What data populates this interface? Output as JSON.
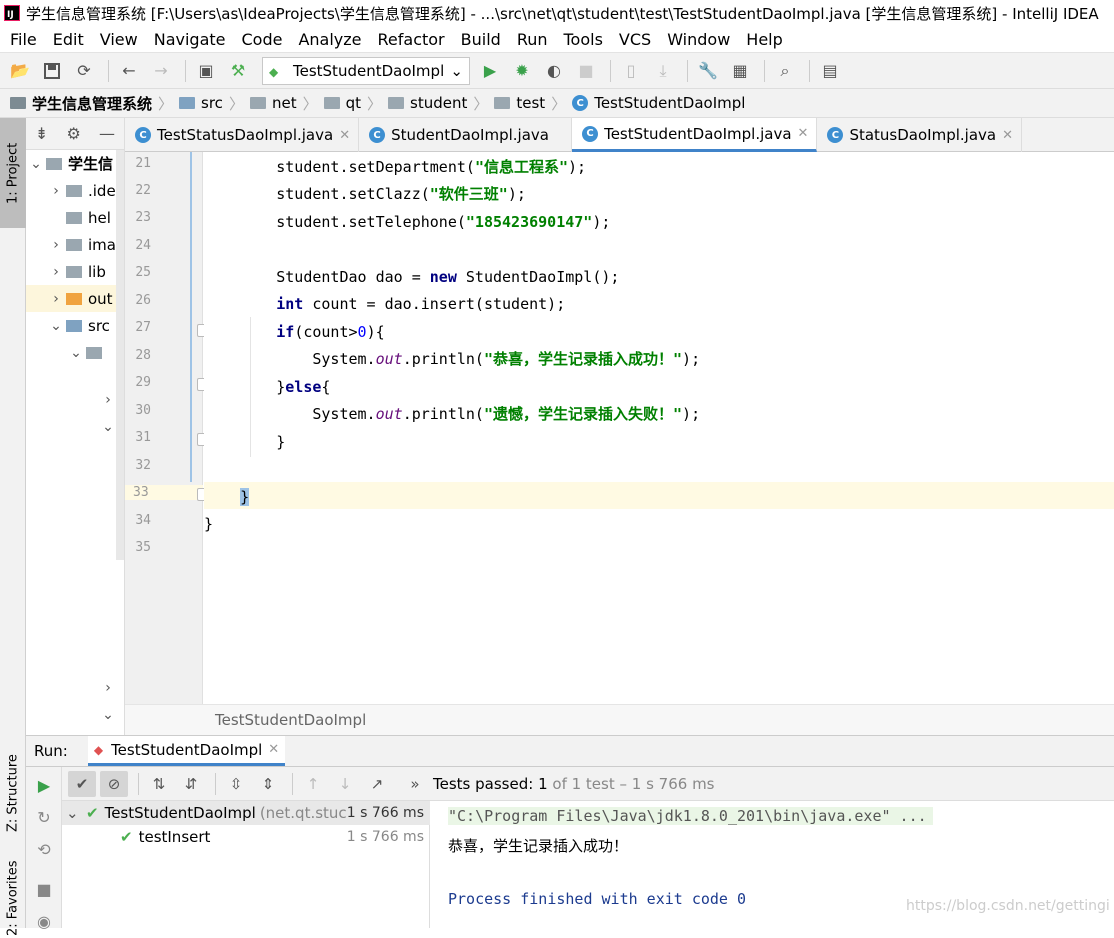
{
  "window": {
    "title": "学生信息管理系统 [F:\\Users\\as\\IdeaProjects\\学生信息管理系统] - ...\\src\\net\\qt\\student\\test\\TestStudentDaoImpl.java [学生信息管理系统] - IntelliJ IDEA",
    "icon": "intellij-icon"
  },
  "menu": [
    "File",
    "Edit",
    "View",
    "Navigate",
    "Code",
    "Analyze",
    "Refactor",
    "Build",
    "Run",
    "Tools",
    "VCS",
    "Window",
    "Help"
  ],
  "toolbar": {
    "run_config": "TestStudentDaoImpl"
  },
  "breadcrumb": [
    "学生信息管理系统",
    "src",
    "net",
    "qt",
    "student",
    "test",
    "TestStudentDaoImpl"
  ],
  "project": {
    "side_tab": "1: Project",
    "items": [
      {
        "label": "学生信",
        "arrow": "⌄"
      },
      {
        "label": ".ide",
        "arrow": "›"
      },
      {
        "label": "hel",
        "arrow": ""
      },
      {
        "label": "ima",
        "arrow": "›"
      },
      {
        "label": "lib",
        "arrow": "›"
      },
      {
        "label": "out",
        "arrow": "›"
      },
      {
        "label": "src",
        "arrow": "⌄"
      },
      {
        "label": "",
        "arrow": "⌄"
      }
    ]
  },
  "tabs": [
    {
      "label": "TestStatusDaoImpl.java",
      "active": false
    },
    {
      "label": "StudentDaoImpl.java",
      "active": false
    },
    {
      "label": "TestStudentDaoImpl.java",
      "active": true
    },
    {
      "label": "StatusDaoImpl.java",
      "active": false
    }
  ],
  "code": {
    "line_numbers": [
      "21",
      "22",
      "23",
      "24",
      "25",
      "26",
      "27",
      "28",
      "29",
      "30",
      "31",
      "32",
      "33",
      "34",
      "35"
    ],
    "lines": [
      {
        "pre": "        student.setDepartment(",
        "str": "\"信息工程系\"",
        "post": ");"
      },
      {
        "pre": "        student.setClazz(",
        "str": "\"软件三班\"",
        "post": ");"
      },
      {
        "pre": "        student.setTelephone(",
        "str": "\"185423690147\"",
        "post": ");"
      }
    ],
    "l25": {
      "a": "        StudentDao dao = ",
      "kw": "new",
      "b": " StudentDaoImpl();"
    },
    "l26": {
      "kw": "int",
      "b": " count = dao.insert(student);"
    },
    "l27": {
      "kw": "if",
      "b": "(count>",
      "num": "0",
      "c": "){"
    },
    "l28": {
      "a": "            System.",
      "fld": "out",
      "b": ".println(",
      "str": "\"恭喜，学生记录插入成功！\"",
      "c": ");"
    },
    "l29": {
      "a": "        }",
      "kw": "else",
      "b": "{"
    },
    "l30": {
      "a": "            System.",
      "fld": "out",
      "b": ".println(",
      "str": "\"遗憾，学生记录插入失败！\"",
      "c": ");"
    },
    "l31": "        }",
    "l33": "    }",
    "l34": "}"
  },
  "editor_footer": "TestStudentDaoImpl",
  "run": {
    "label": "Run:",
    "tab": "TestStudentDaoImpl",
    "status_prefix": "Tests passed:",
    "status_count": "1",
    "status_suffix": "of 1 test – 1 s 766 ms",
    "tree": [
      {
        "name": "TestStudentDaoImpl",
        "pkg": "(net.qt.stuc",
        "time": "1 s 766 ms"
      },
      {
        "name": "testInsert",
        "pkg": "",
        "time": "1 s 766 ms"
      }
    ],
    "console": [
      "\"C:\\Program Files\\Java\\jdk1.8.0_201\\bin\\java.exe\" ...",
      "恭喜，学生记录插入成功！",
      "",
      "Process finished with exit code 0"
    ]
  },
  "side_tabs": {
    "structure": "Z: Structure",
    "favorites": "2: Favorites"
  },
  "watermark": "https://blog.csdn.net/gettingi"
}
